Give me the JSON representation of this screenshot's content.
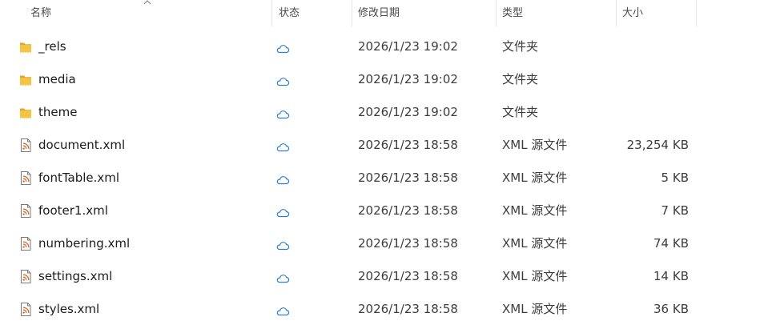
{
  "columns": {
    "name": "名称",
    "status": "状态",
    "modified": "修改日期",
    "type": "类型",
    "size": "大小"
  },
  "sort_icon": "chevron-up-icon",
  "status_icon": "cloud-icon",
  "colors": {
    "folder": "#f6c445",
    "folder_dark": "#e3a52b",
    "xml_accent": "#d56b2b",
    "cloud": "#2a7fd0"
  },
  "files": [
    {
      "name": "_rels",
      "icon": "folder-icon",
      "modified": "2026/1/23 19:02",
      "type": "文件夹",
      "size": ""
    },
    {
      "name": "media",
      "icon": "folder-icon",
      "modified": "2026/1/23 19:02",
      "type": "文件夹",
      "size": ""
    },
    {
      "name": "theme",
      "icon": "folder-icon",
      "modified": "2026/1/23 19:02",
      "type": "文件夹",
      "size": ""
    },
    {
      "name": "document.xml",
      "icon": "xml-file-icon",
      "modified": "2026/1/23 18:58",
      "type": "XML 源文件",
      "size": "23,254 KB"
    },
    {
      "name": "fontTable.xml",
      "icon": "xml-file-icon",
      "modified": "2026/1/23 18:58",
      "type": "XML 源文件",
      "size": "5 KB"
    },
    {
      "name": "footer1.xml",
      "icon": "xml-file-icon",
      "modified": "2026/1/23 18:58",
      "type": "XML 源文件",
      "size": "7 KB"
    },
    {
      "name": "numbering.xml",
      "icon": "xml-file-icon",
      "modified": "2026/1/23 18:58",
      "type": "XML 源文件",
      "size": "74 KB"
    },
    {
      "name": "settings.xml",
      "icon": "xml-file-icon",
      "modified": "2026/1/23 18:58",
      "type": "XML 源文件",
      "size": "14 KB"
    },
    {
      "name": "styles.xml",
      "icon": "xml-file-icon",
      "modified": "2026/1/23 18:58",
      "type": "XML 源文件",
      "size": "36 KB"
    }
  ]
}
